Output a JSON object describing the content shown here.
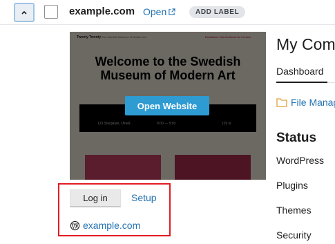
{
  "site": {
    "name": "example.com",
    "open_label": "Open",
    "add_label": "ADD LABEL"
  },
  "preview": {
    "site_title": "Twenty Twenty",
    "site_description": "The Swedish Museum of Modern Art",
    "nav_links": "Exhibitions  Visit Us  About Us  Contact",
    "heading_line1": "Welcome to the Swedish",
    "heading_line2": "Museum of Modern Art",
    "info_address": "123 Storgatan, Umeå",
    "info_hours": "9:00 — 5:00",
    "info_price": "129 kr",
    "open_website_label": "Open Website"
  },
  "actions": {
    "login_label": "Log in",
    "setup_label": "Setup",
    "wp_link": "example.com"
  },
  "panel": {
    "title": "My Com",
    "tab": "Dashboard",
    "file_manager": "File Manag",
    "status_heading": "Status",
    "status_items": [
      "WordPress",
      "Plugins",
      "Themes",
      "Security"
    ]
  },
  "colors": {
    "link": "#2271b1",
    "highlight": "#e31b23",
    "open_website_bg": "#2e9bd3"
  }
}
